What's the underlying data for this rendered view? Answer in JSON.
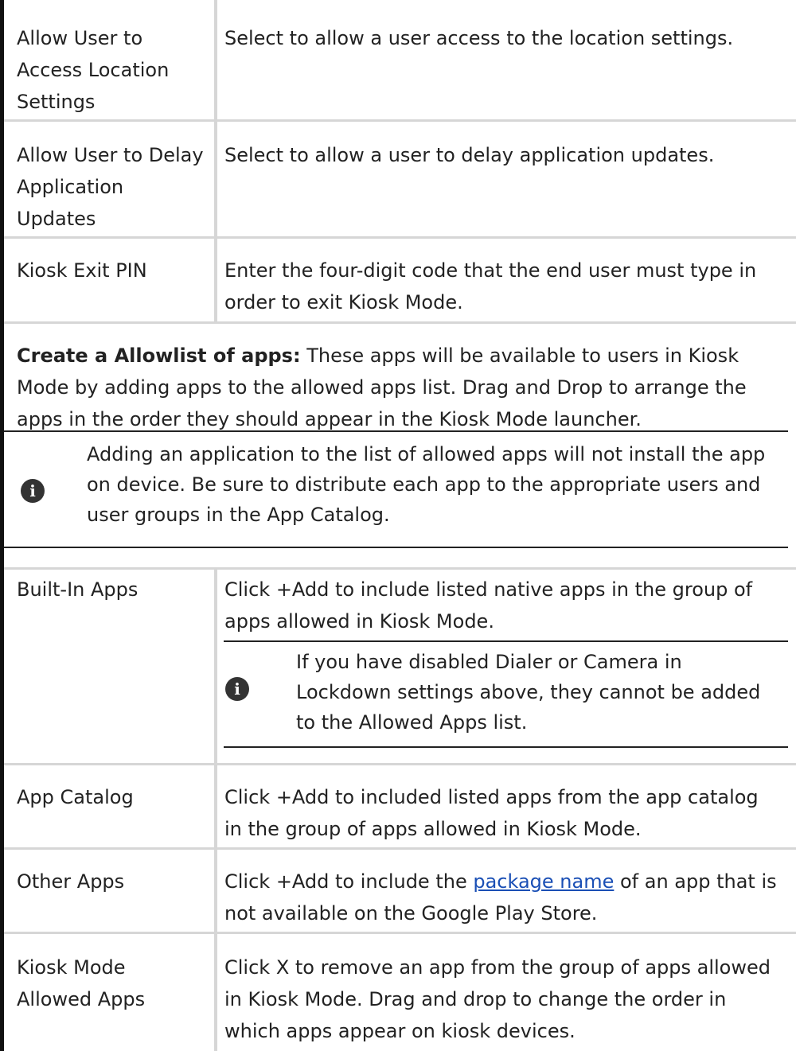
{
  "rows_top": [
    {
      "setting": "Allow User to Access Location Settings",
      "description": "Select to allow a user access to the location settings."
    },
    {
      "setting": "Allow User to Delay Application Updates",
      "description": "Select to allow a user to delay application updates."
    },
    {
      "setting": "Kiosk Exit PIN",
      "description": "Enter the four-digit code that the end user must type in order to exit Kiosk Mode."
    }
  ],
  "allowlist_section": {
    "heading": "Create a Allowlist of apps:",
    "text": " These apps will be available to users in Kiosk Mode by adding apps to the allowed apps list. Drag and Drop to arrange the apps in the order they should appear in the Kiosk Mode launcher.",
    "note": "Adding an application to the list of allowed apps will not install the app on device. Be sure to distribute each app to the appropriate users and user groups in the App Catalog."
  },
  "rows_bottom": [
    {
      "setting": "Built-In Apps",
      "description": "Click +Add to include listed native apps in the group of apps allowed in Kiosk Mode.",
      "note": "If you have disabled Dialer or Camera in Lockdown settings above, they cannot be added to the Allowed Apps list."
    },
    {
      "setting": "App Catalog",
      "description": "Click +Add to included listed apps from the app catalog in the group of apps allowed in Kiosk Mode."
    },
    {
      "setting": "Other Apps",
      "description_before": "Click +Add to include the ",
      "description_link": "package name",
      "description_after": " of an app that is not available on the Google Play Store."
    },
    {
      "setting": "Kiosk Mode Allowed Apps",
      "description": "Click X to remove an app from the group of apps allowed in Kiosk Mode. Drag and drop to change the order in which apps appear on kiosk devices."
    }
  ],
  "icons": {
    "info": "info-icon",
    "info_glyph": "i"
  }
}
